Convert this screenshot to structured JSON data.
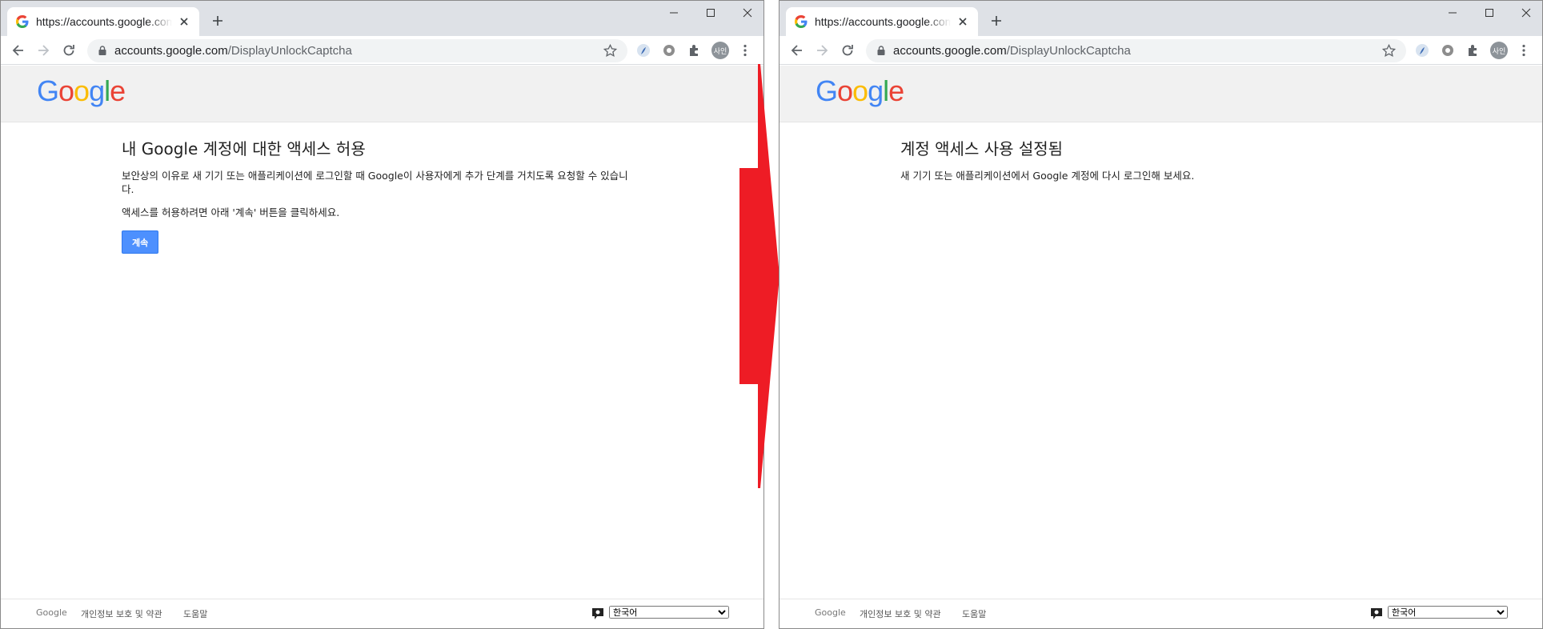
{
  "colors": {
    "arrow": "#ee1c25",
    "button": "#4d90fe",
    "g_blue": "#4285f4",
    "g_red": "#ea4335",
    "g_yellow": "#fbbc05",
    "g_green": "#34a853"
  },
  "browser": {
    "tab_title": "https://accounts.google.com/DisplayUnlockCaptcha",
    "url_domain": "accounts.google.com",
    "url_path": "/DisplayUnlockCaptcha",
    "profile_label": "사인"
  },
  "logo": {
    "letters": [
      "G",
      "o",
      "o",
      "g",
      "l",
      "e"
    ]
  },
  "left_page": {
    "title": "내 Google 계정에 대한 액세스 허용",
    "paragraph1": "보안상의 이유로 새 기기 또는 애플리케이션에 로그인할 때 Google이 사용자에게 추가 단계를 거치도록 요청할 수 있습니다.",
    "paragraph2": "액세스를 허용하려면 아래 '계속' 버튼을 클릭하세요.",
    "continue_label": "계속"
  },
  "right_page": {
    "title": "계정 액세스 사용 설정됨",
    "paragraph1": "새 기기 또는 애플리케이션에서 Google 계정에 다시 로그인해 보세요."
  },
  "footer": {
    "google": "Google",
    "privacy": "개인정보 보호 및 약관",
    "help": "도움말",
    "language": "한국어"
  },
  "icons": {
    "back": "back-arrow-icon",
    "forward": "forward-arrow-icon",
    "reload": "reload-icon",
    "lock": "lock-icon",
    "star": "bookmark-star-icon",
    "puzzle": "extensions-puzzle-icon",
    "menu": "kebab-menu-icon",
    "arrow": "red-right-arrow"
  }
}
